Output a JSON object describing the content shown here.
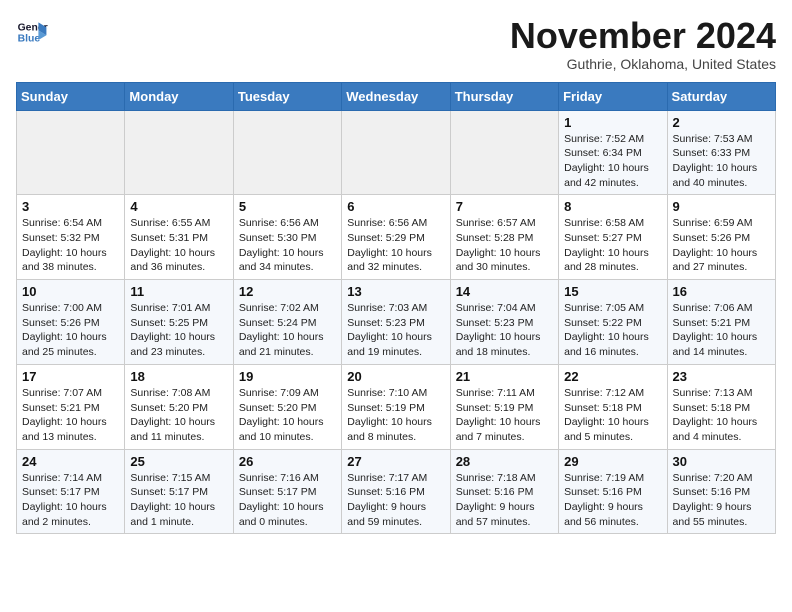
{
  "logo": {
    "line1": "General",
    "line2": "Blue"
  },
  "title": "November 2024",
  "subtitle": "Guthrie, Oklahoma, United States",
  "days_of_week": [
    "Sunday",
    "Monday",
    "Tuesday",
    "Wednesday",
    "Thursday",
    "Friday",
    "Saturday"
  ],
  "weeks": [
    [
      {
        "day": "",
        "info": ""
      },
      {
        "day": "",
        "info": ""
      },
      {
        "day": "",
        "info": ""
      },
      {
        "day": "",
        "info": ""
      },
      {
        "day": "",
        "info": ""
      },
      {
        "day": "1",
        "info": "Sunrise: 7:52 AM\nSunset: 6:34 PM\nDaylight: 10 hours and 42 minutes."
      },
      {
        "day": "2",
        "info": "Sunrise: 7:53 AM\nSunset: 6:33 PM\nDaylight: 10 hours and 40 minutes."
      }
    ],
    [
      {
        "day": "3",
        "info": "Sunrise: 6:54 AM\nSunset: 5:32 PM\nDaylight: 10 hours and 38 minutes."
      },
      {
        "day": "4",
        "info": "Sunrise: 6:55 AM\nSunset: 5:31 PM\nDaylight: 10 hours and 36 minutes."
      },
      {
        "day": "5",
        "info": "Sunrise: 6:56 AM\nSunset: 5:30 PM\nDaylight: 10 hours and 34 minutes."
      },
      {
        "day": "6",
        "info": "Sunrise: 6:56 AM\nSunset: 5:29 PM\nDaylight: 10 hours and 32 minutes."
      },
      {
        "day": "7",
        "info": "Sunrise: 6:57 AM\nSunset: 5:28 PM\nDaylight: 10 hours and 30 minutes."
      },
      {
        "day": "8",
        "info": "Sunrise: 6:58 AM\nSunset: 5:27 PM\nDaylight: 10 hours and 28 minutes."
      },
      {
        "day": "9",
        "info": "Sunrise: 6:59 AM\nSunset: 5:26 PM\nDaylight: 10 hours and 27 minutes."
      }
    ],
    [
      {
        "day": "10",
        "info": "Sunrise: 7:00 AM\nSunset: 5:26 PM\nDaylight: 10 hours and 25 minutes."
      },
      {
        "day": "11",
        "info": "Sunrise: 7:01 AM\nSunset: 5:25 PM\nDaylight: 10 hours and 23 minutes."
      },
      {
        "day": "12",
        "info": "Sunrise: 7:02 AM\nSunset: 5:24 PM\nDaylight: 10 hours and 21 minutes."
      },
      {
        "day": "13",
        "info": "Sunrise: 7:03 AM\nSunset: 5:23 PM\nDaylight: 10 hours and 19 minutes."
      },
      {
        "day": "14",
        "info": "Sunrise: 7:04 AM\nSunset: 5:23 PM\nDaylight: 10 hours and 18 minutes."
      },
      {
        "day": "15",
        "info": "Sunrise: 7:05 AM\nSunset: 5:22 PM\nDaylight: 10 hours and 16 minutes."
      },
      {
        "day": "16",
        "info": "Sunrise: 7:06 AM\nSunset: 5:21 PM\nDaylight: 10 hours and 14 minutes."
      }
    ],
    [
      {
        "day": "17",
        "info": "Sunrise: 7:07 AM\nSunset: 5:21 PM\nDaylight: 10 hours and 13 minutes."
      },
      {
        "day": "18",
        "info": "Sunrise: 7:08 AM\nSunset: 5:20 PM\nDaylight: 10 hours and 11 minutes."
      },
      {
        "day": "19",
        "info": "Sunrise: 7:09 AM\nSunset: 5:20 PM\nDaylight: 10 hours and 10 minutes."
      },
      {
        "day": "20",
        "info": "Sunrise: 7:10 AM\nSunset: 5:19 PM\nDaylight: 10 hours and 8 minutes."
      },
      {
        "day": "21",
        "info": "Sunrise: 7:11 AM\nSunset: 5:19 PM\nDaylight: 10 hours and 7 minutes."
      },
      {
        "day": "22",
        "info": "Sunrise: 7:12 AM\nSunset: 5:18 PM\nDaylight: 10 hours and 5 minutes."
      },
      {
        "day": "23",
        "info": "Sunrise: 7:13 AM\nSunset: 5:18 PM\nDaylight: 10 hours and 4 minutes."
      }
    ],
    [
      {
        "day": "24",
        "info": "Sunrise: 7:14 AM\nSunset: 5:17 PM\nDaylight: 10 hours and 2 minutes."
      },
      {
        "day": "25",
        "info": "Sunrise: 7:15 AM\nSunset: 5:17 PM\nDaylight: 10 hours and 1 minute."
      },
      {
        "day": "26",
        "info": "Sunrise: 7:16 AM\nSunset: 5:17 PM\nDaylight: 10 hours and 0 minutes."
      },
      {
        "day": "27",
        "info": "Sunrise: 7:17 AM\nSunset: 5:16 PM\nDaylight: 9 hours and 59 minutes."
      },
      {
        "day": "28",
        "info": "Sunrise: 7:18 AM\nSunset: 5:16 PM\nDaylight: 9 hours and 57 minutes."
      },
      {
        "day": "29",
        "info": "Sunrise: 7:19 AM\nSunset: 5:16 PM\nDaylight: 9 hours and 56 minutes."
      },
      {
        "day": "30",
        "info": "Sunrise: 7:20 AM\nSunset: 5:16 PM\nDaylight: 9 hours and 55 minutes."
      }
    ]
  ]
}
